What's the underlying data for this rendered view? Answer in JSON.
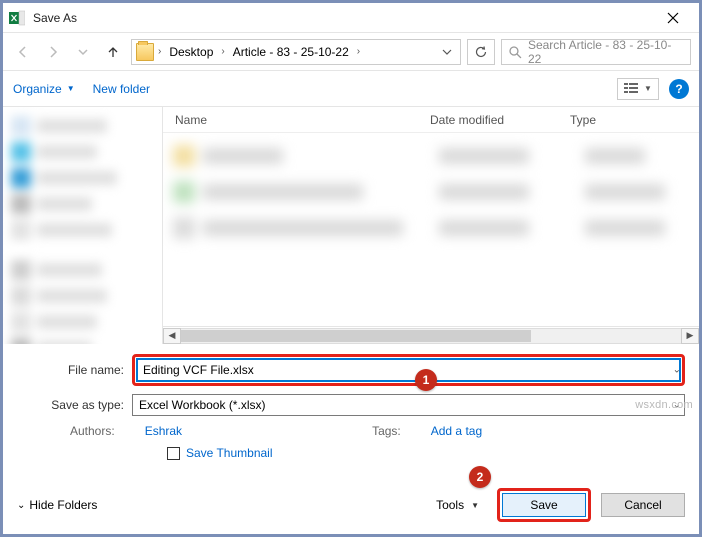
{
  "window": {
    "title": "Save As"
  },
  "path": {
    "segments": [
      "Desktop",
      "Article - 83 - 25-10-22"
    ]
  },
  "refresh_tooltip": "Refresh",
  "search": {
    "placeholder": "Search Article - 83 - 25-10-22"
  },
  "toolbar": {
    "organize": "Organize",
    "new_folder": "New folder"
  },
  "columns": {
    "name": "Name",
    "date": "Date modified",
    "type": "Type"
  },
  "form": {
    "file_name_label": "File name:",
    "file_name_value": "Editing VCF File.xlsx",
    "save_type_label": "Save as type:",
    "save_type_value": "Excel Workbook (*.xlsx)",
    "authors_label": "Authors:",
    "authors_value": "Eshrak",
    "tags_label": "Tags:",
    "tags_value": "Add a tag",
    "save_thumbnail": "Save Thumbnail"
  },
  "footer": {
    "hide_folders": "Hide Folders",
    "tools": "Tools",
    "save": "Save",
    "cancel": "Cancel"
  },
  "badges": {
    "b1": "1",
    "b2": "2"
  },
  "watermark": "wsxdn.com"
}
